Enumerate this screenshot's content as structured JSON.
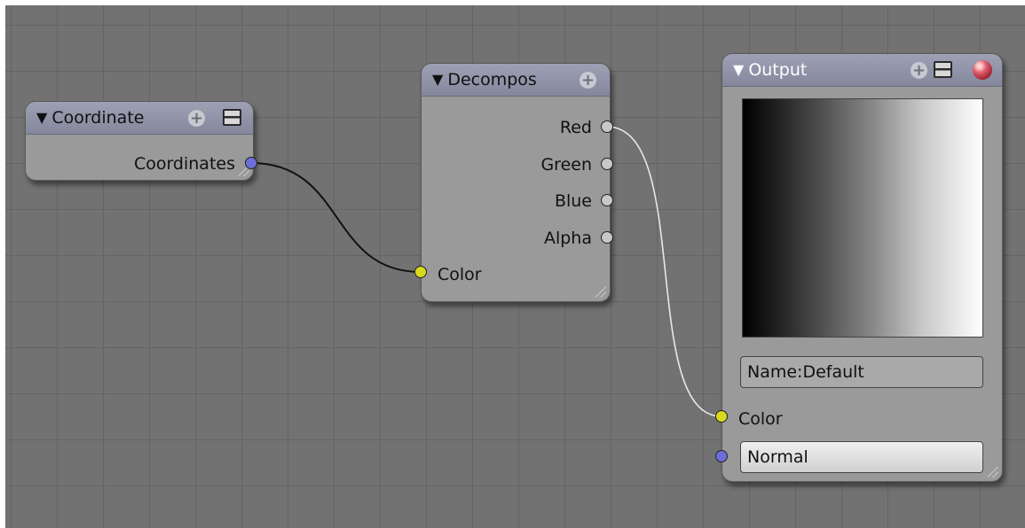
{
  "nodes": {
    "coordinate": {
      "title": "Coordinate",
      "outputs": [
        "Coordinates"
      ]
    },
    "decompose": {
      "title": "Decompos",
      "outputs": [
        "Red",
        "Green",
        "Blue",
        "Alpha"
      ],
      "inputs": [
        "Color"
      ]
    },
    "output": {
      "title": "Output",
      "name_field": "Name:Default",
      "inputs": [
        "Color"
      ],
      "normal_value": "Normal"
    }
  },
  "icons": {
    "collapse": "triangle-down-icon",
    "add": "plus-icon",
    "options": "list-icon",
    "preview": "sphere-icon"
  },
  "colors": {
    "socket_vector": "#6d6dd8",
    "socket_color": "#d8d820",
    "socket_value": "#c8c8c8",
    "header": "#9094aa",
    "grid_bg": "#727272"
  }
}
